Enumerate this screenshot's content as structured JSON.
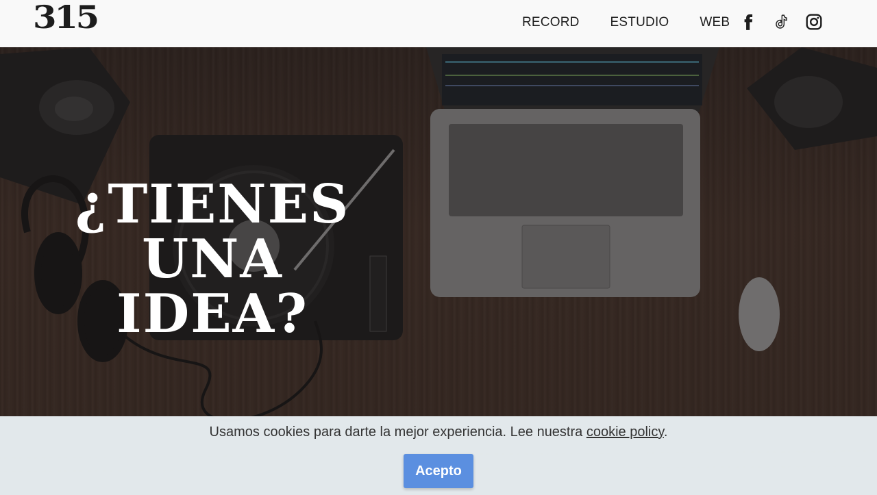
{
  "header": {
    "logo_text": "315",
    "nav": [
      {
        "label": "RECORD"
      },
      {
        "label": "ESTUDIO"
      },
      {
        "label": "WEB"
      }
    ],
    "socials": [
      "facebook-icon",
      "tiktok-icon",
      "instagram-icon"
    ]
  },
  "hero": {
    "headline_lines": [
      "¿TIENES",
      "UNA",
      "IDEA?"
    ]
  },
  "cookie_bar": {
    "text": "Usamos cookies para darte la mejor experiencia. Lee nuestra",
    "link_label": "cookie policy",
    "suffix": ".",
    "button_label": "Acepto"
  },
  "colors": {
    "header_bg": "#f9f9f9",
    "text_dark": "#1d1d1d",
    "button_blue": "#5b8fe0",
    "cookie_bg": "#e8eef2"
  }
}
